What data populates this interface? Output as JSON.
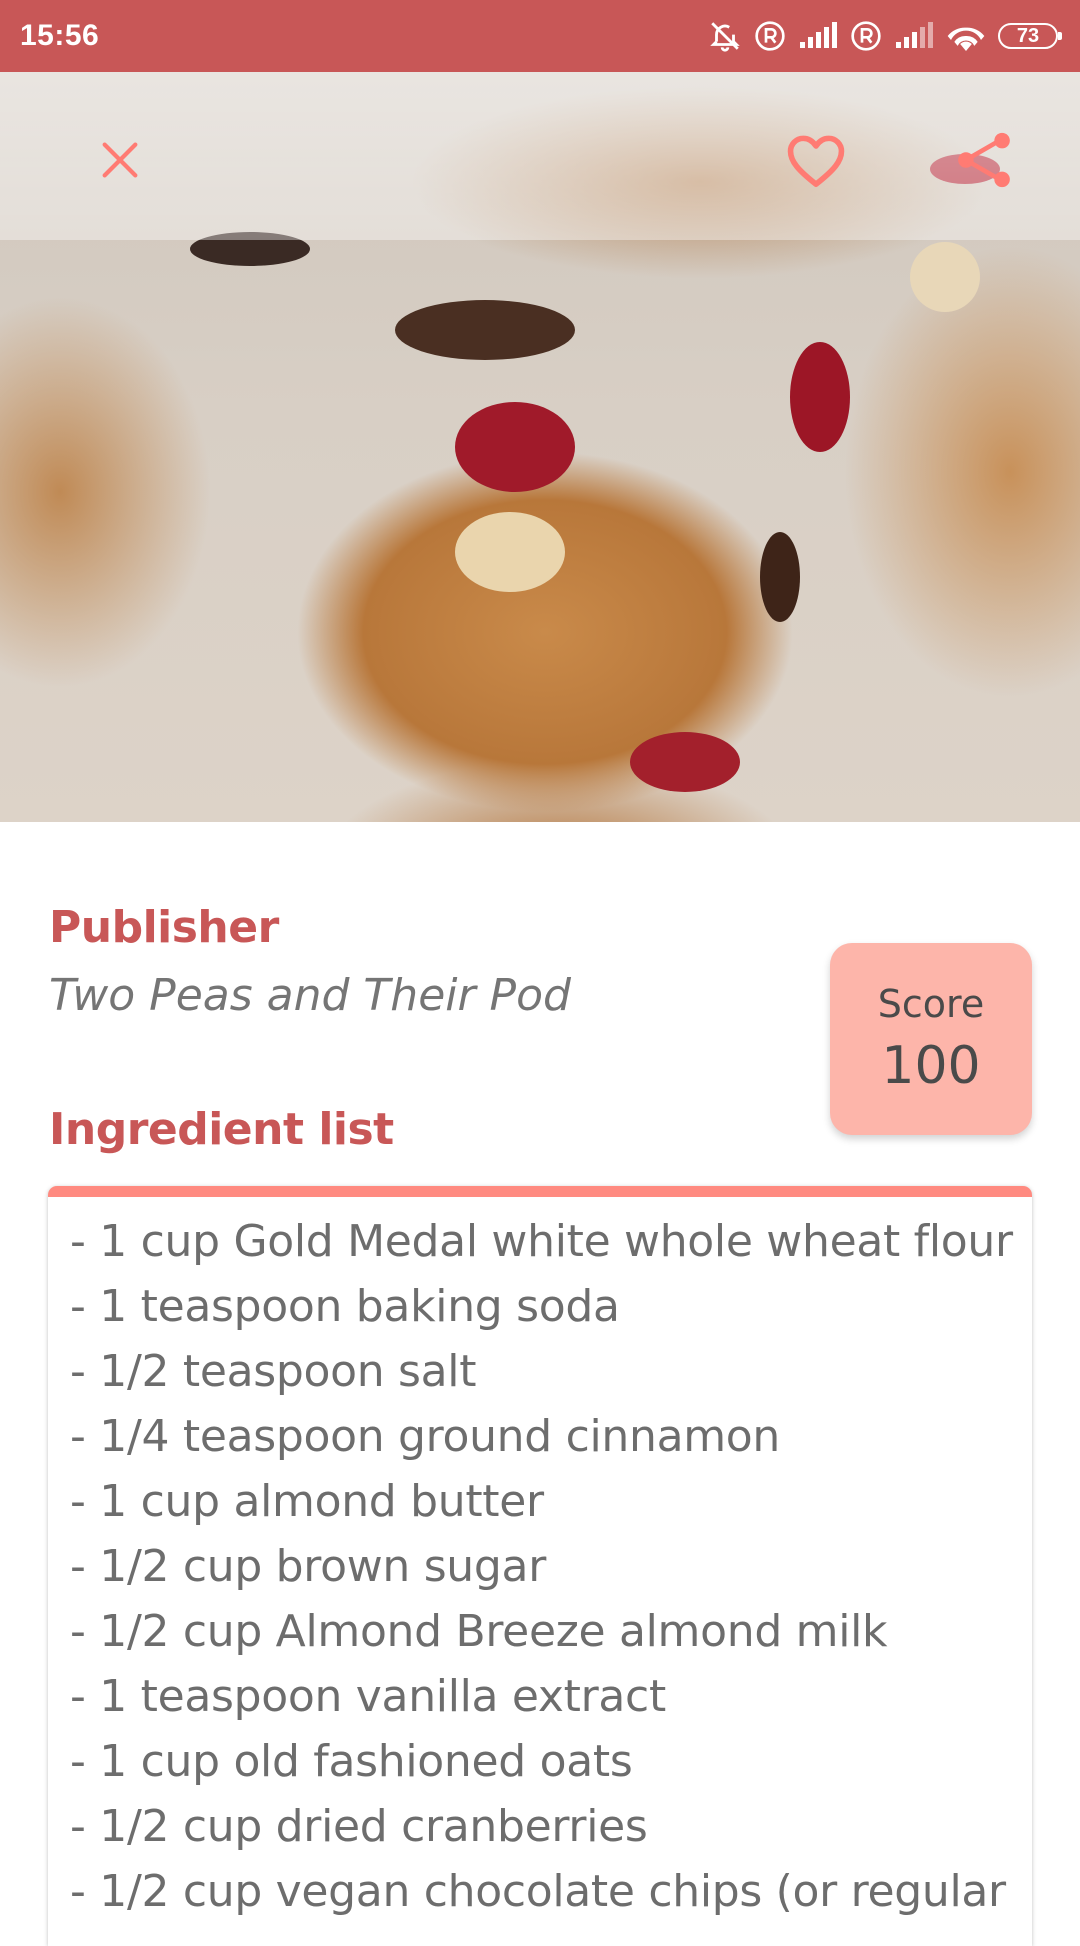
{
  "status_bar": {
    "time": "15:56",
    "battery": "73",
    "icons": [
      "mute-bell-icon",
      "registered-icon",
      "signal-icon",
      "registered-icon",
      "signal-icon",
      "wifi-icon",
      "battery-icon"
    ],
    "background": "#c85757"
  },
  "toolbar": {
    "icons": [
      "close-icon",
      "heart-icon",
      "share-icon"
    ],
    "accent": "#ff7b73"
  },
  "publisher": {
    "label": "Publisher",
    "name": "Two Peas and Their Pod"
  },
  "score": {
    "label": "Score",
    "value": "100",
    "background": "#fdb5aa"
  },
  "ingredients": {
    "label": "Ingredient list",
    "accent": "#ff8a80",
    "items": [
      "- 1 cup Gold Medal white whole wheat flour",
      "- 1 teaspoon baking soda",
      "- 1/2 teaspoon salt",
      "- 1/4 teaspoon ground cinnamon",
      "- 1 cup almond butter",
      "- 1/2 cup brown sugar",
      "- 1/2 cup Almond Breeze almond milk",
      "- 1 teaspoon vanilla extract",
      "- 1 cup old fashioned oats",
      "- 1/2 cup dried cranberries",
      "- 1/2 cup vegan chocolate chips (or regular"
    ]
  }
}
